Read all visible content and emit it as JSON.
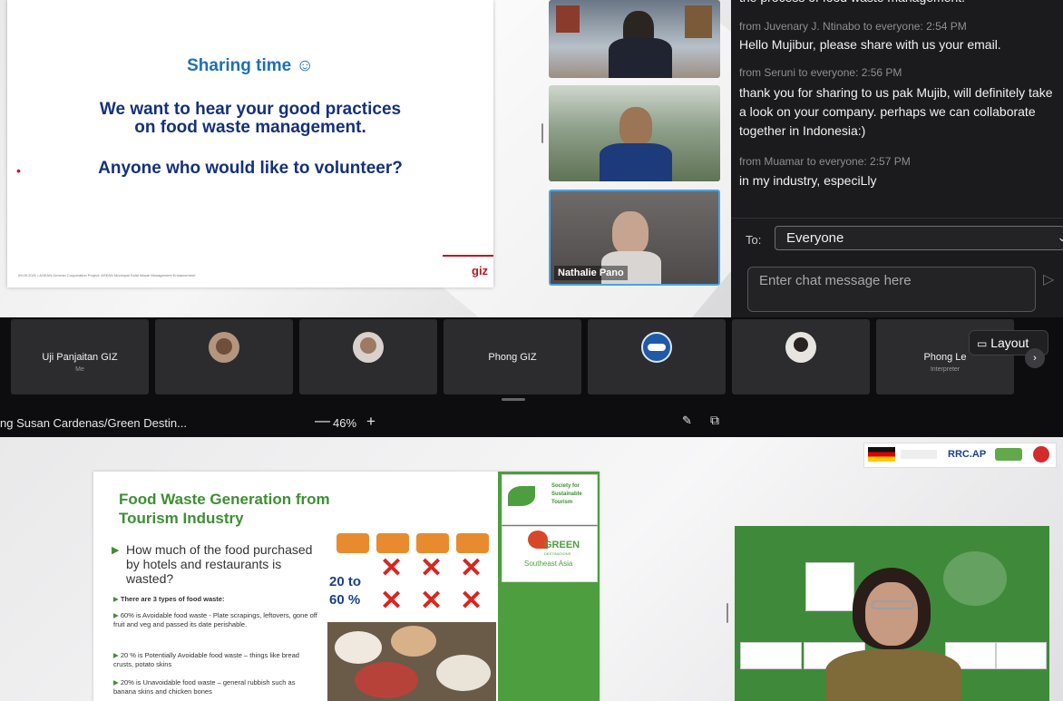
{
  "top_slide": {
    "title": "Sharing time ☺",
    "line1": "We want to hear your good practices",
    "line2": "on food waste management.",
    "line3": "Anyone who would like to volunteer?",
    "footer": "09.09.2021   •   ASEAN-German Cooperation Project: ASEAN Municipal Solid Waste Management Enhancement",
    "logo": "giz"
  },
  "videos": {
    "tile3_name": "Nathalie Pano"
  },
  "chat": {
    "partial_top": "the process of food waste management.",
    "messages": [
      {
        "meta": "from Juvenary J. Ntinabo to everyone:   2:54 PM",
        "text": "Hello Mujibur, please share with us your email."
      },
      {
        "meta": "from Seruni to everyone:   2:56 PM",
        "text": "thank you for sharing to us pak Mujib, will definitely take a look on your company. perhaps we can collaborate together in Indonesia:)"
      },
      {
        "meta": "from Muamar to everyone:   2:57 PM",
        "text": "in my industry, especiLly"
      }
    ],
    "to_label": "To:",
    "to_value": "Everyone",
    "input_placeholder": "Enter chat message here"
  },
  "participants": [
    {
      "name": "Uji Panjaitan GIZ",
      "sub": "Me"
    },
    {
      "name": "",
      "sub": ""
    },
    {
      "name": "",
      "sub": ""
    },
    {
      "name": "Phong GIZ",
      "sub": ""
    },
    {
      "name": "",
      "sub": ""
    },
    {
      "name": "",
      "sub": ""
    },
    {
      "name": "Phong Le",
      "sub": "Interpreter"
    }
  ],
  "layout_button": "Layout",
  "sharebar": {
    "presenter": "ng Susan Cardenas/Green Destin...",
    "zoom_minus": "—",
    "zoom": "46%",
    "zoom_plus": "+"
  },
  "bottom_slide": {
    "title_line1": "Food Waste Generation from",
    "title_line2": "Tourism Industry",
    "question": "How much of the food purchased by hotels and restaurants is wasted?",
    "bullets": [
      "There are 3 types of food waste:",
      "60% is Avoidable food waste - Plate scrapings, leftovers, gone off fruit and veg and passed its date perishable.",
      "20 % is Potentially Avoidable food waste – things like bread crusts, potato skins",
      "20% is Unavoidable food waste – general rubbish such as banana skins and chicken bones"
    ],
    "pct_line1": "20 to",
    "pct_line2": "60 %",
    "logo1_line1": "Society for",
    "logo1_line2": "Sustainable",
    "logo1_line3": "Tourism",
    "logo2_line1": "GREEN",
    "logo2_line2": "DESTINATIONS",
    "logo2_line3": "Southeast Asia"
  },
  "partner_logos": "RRC.AP"
}
